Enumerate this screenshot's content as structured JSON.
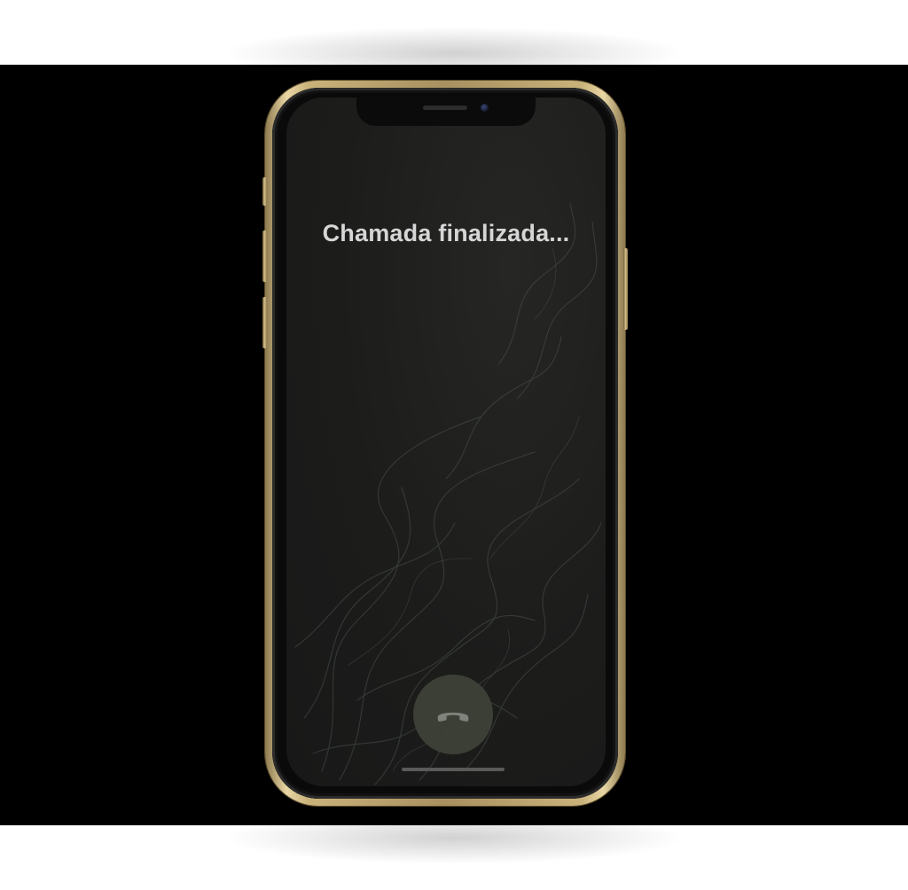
{
  "call": {
    "status_text": "Chamada finalizada..."
  },
  "controls": {
    "end_call_icon": "phone-hangup-icon"
  },
  "colors": {
    "frame_gold": "#c9b27a",
    "background": "#000000",
    "screen": "#1c1c1b",
    "status_text": "#d6d6d6",
    "end_call_button": "#3f433a"
  }
}
